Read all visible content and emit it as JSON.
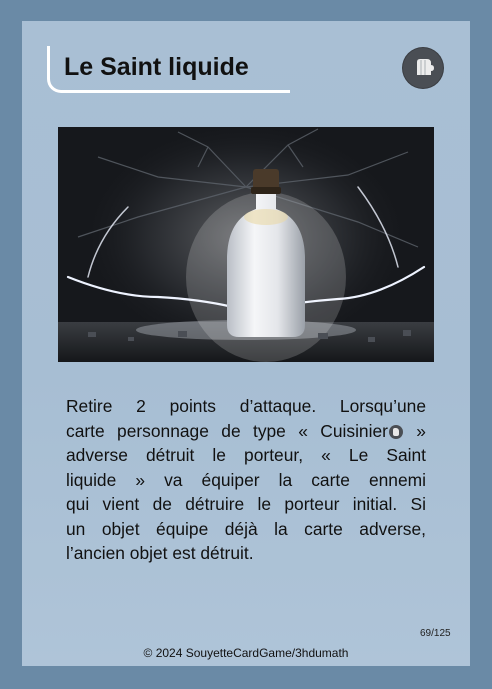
{
  "card": {
    "title": "Le Saint liquide",
    "type_icon": "cook-hand-icon",
    "description_lines": [
      "Retire 2 points d’attaque. Lorsqu’une",
      "carte personnage de type « Cuisinier",
      "adverse détruit le porteur, « Le Saint",
      "liquide » va équiper la carte ennemi",
      "qui vient de détruire le porteur initial. Si",
      "un objet équipe déjà la carte adverse,",
      "l’ancien objet est détruit."
    ],
    "description_after_icon": " »",
    "number": "69/125",
    "copyright": "© 2024 SouyetteCardGame/3hdumath"
  },
  "colors": {
    "frame": "#6a8aa6",
    "panel": "#a9bfd4",
    "badge": "#4a4e54"
  }
}
